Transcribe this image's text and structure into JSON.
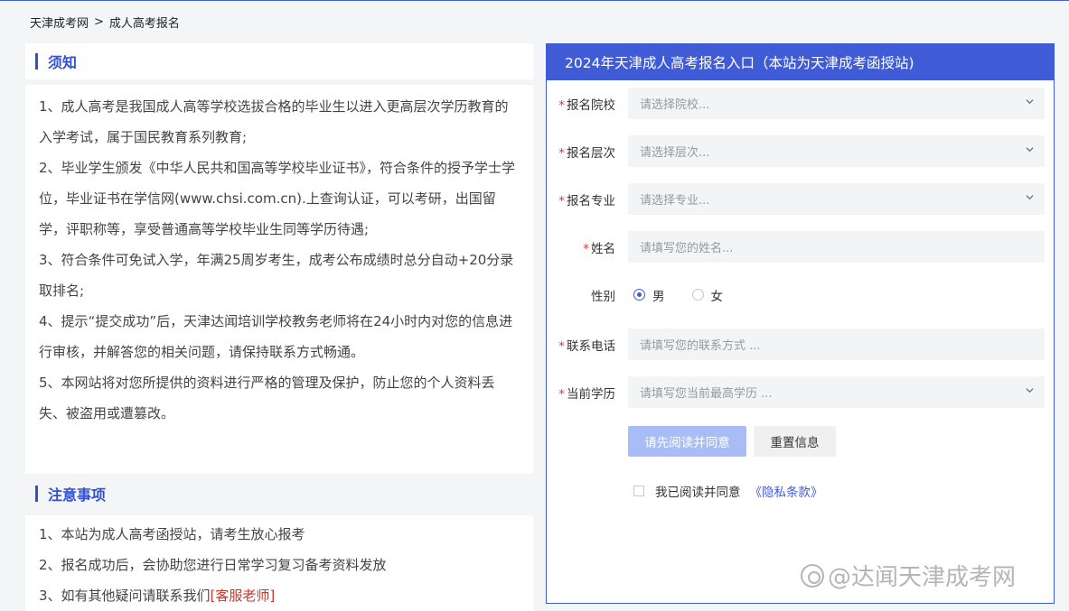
{
  "breadcrumb": {
    "home": "天津成考网",
    "separator": ">",
    "current": "成人高考报名"
  },
  "notice": {
    "title": "须知",
    "items": [
      "1、成人高考是我国成人高等学校选拔合格的毕业生以进入更高层次学历教育的入学考试，属于国民教育系列教育;",
      "2、毕业学生颁发《中华人民共和国高等学校毕业证书》，符合条件的授予学士学位，毕业证书在学信网(www.chsi.com.cn).上查询认证，可以考研，出国留学，评职称等，享受普通高等学校毕业生同等学历待遇;",
      "3、符合条件可免试入学，年满25周岁考生，成考公布成绩时总分自动+20分录取排名;",
      "4、提示“提交成功”后，天津达闻培训学校教务老师将在24小时内对您的信息进行审核，并解答您的相关问题，请保持联系方式畅通。",
      "5、本网站将对您所提供的资料进行严格的管理及保护，防止您的个人资料丢失、被盗用或遭篡改。"
    ]
  },
  "attention": {
    "title": "注意事项",
    "item1": "1、本站为成人高考函授站，请考生放心报考",
    "item2": "2、报名成功后，会协助您进行日常学习复习备考资料发放",
    "item3_prefix": "3、如有其他疑问请联系我们",
    "item3_link": "[客服老师]"
  },
  "form": {
    "title": "2024年天津成人高考报名入口（本站为天津成考函授站)",
    "required_mark": "*",
    "school": {
      "label": "报名院校",
      "placeholder": "请选择院校..."
    },
    "level": {
      "label": "报名层次",
      "placeholder": "请选择层次..."
    },
    "major": {
      "label": "报名专业",
      "placeholder": "请选择专业..."
    },
    "name": {
      "label": "姓名",
      "placeholder": "请填写您的姓名..."
    },
    "gender": {
      "label": "性别",
      "male": "男",
      "female": "女",
      "selected": "男"
    },
    "phone": {
      "label": "联系电话",
      "placeholder": "请填写您的联系方式 ..."
    },
    "education": {
      "label": "当前学历",
      "placeholder": "请填写您当前最高学历 ..."
    },
    "submit_label": "请先阅读并同意",
    "reset_label": "重置信息",
    "agree_text": "我已阅读并同意",
    "privacy_link": "《隐私条款》"
  },
  "watermark": "@达闻天津成考网",
  "colors": {
    "accent": "#3f5bd6",
    "required": "#ee3333",
    "link_red": "#c0392b",
    "disabled_button": "#a8bdf5"
  }
}
